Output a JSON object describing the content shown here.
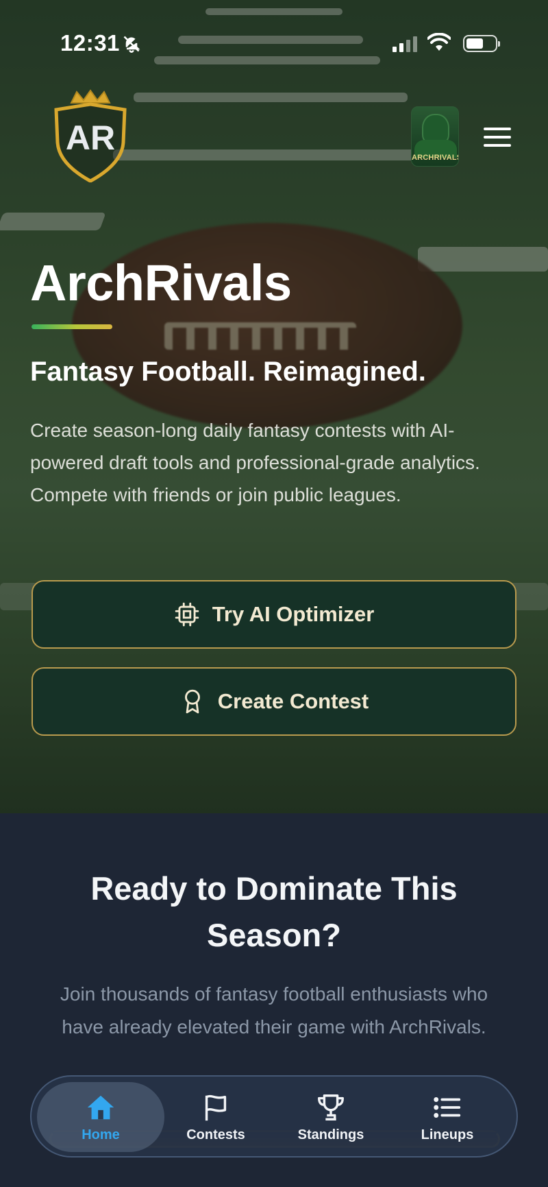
{
  "status_bar": {
    "time": "12:31"
  },
  "header": {
    "logo_text": "AR",
    "avatar_text": "ARCHRIVALS"
  },
  "hero": {
    "title": "ArchRivals",
    "tagline": "Fantasy Football. Reimagined.",
    "description": "Create season-long daily fantasy contests with AI-powered draft tools and professional-grade analytics. Compete with friends or join public leagues.",
    "buttons": [
      {
        "label": "Try AI Optimizer",
        "icon": "cpu-chip-icon"
      },
      {
        "label": "Create Contest",
        "icon": "award-ribbon-icon"
      }
    ]
  },
  "cta_section": {
    "heading": "Ready to Dominate This Season?",
    "text": "Join thousands of fantasy football enthusiasts who have already elevated their game with ArchRivals."
  },
  "tab_bar": {
    "active": "Home",
    "tabs": [
      {
        "label": "Home",
        "icon": "home-icon"
      },
      {
        "label": "Contests",
        "icon": "flag-icon"
      },
      {
        "label": "Standings",
        "icon": "trophy-icon"
      },
      {
        "label": "Lineups",
        "icon": "list-icon"
      }
    ]
  },
  "colors": {
    "button_bg": "#163227",
    "button_border": "#b99b4e",
    "accent_blue": "#33a7ef",
    "section_bg": "#1e2635"
  }
}
